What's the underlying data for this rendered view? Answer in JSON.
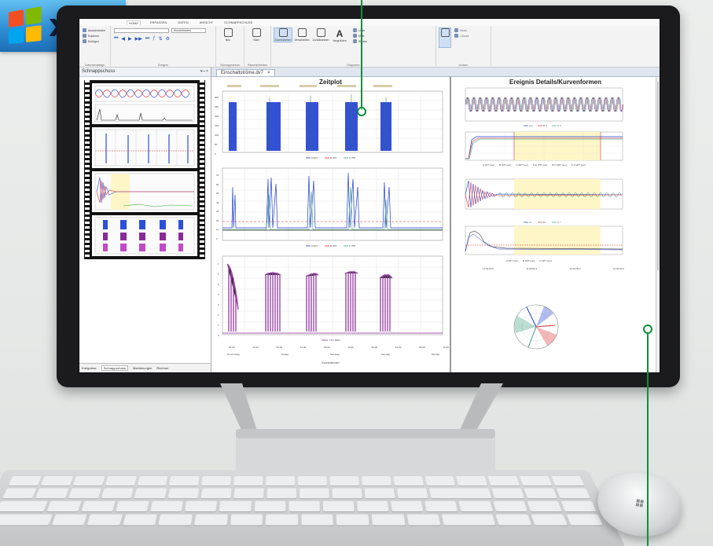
{
  "badge": {
    "text": "x64",
    "logo_colors": [
      "#f25022",
      "#7fba00",
      "#00a4ef",
      "#ffb900"
    ]
  },
  "ribbon": {
    "tabs": [
      "HOME",
      "ERFASSEN",
      "DATEN",
      "ANSICHT",
      "SCHNAPPSCHUSS"
    ],
    "groups": [
      {
        "label": "Zwischenablage",
        "buttons": [
          "Ausschneiden",
          "Kopieren",
          "Einfügen"
        ]
      },
      {
        "label": "Ereignis",
        "buttons": [
          "Kurvenformen"
        ]
      },
      {
        "label": "Schnappschuss",
        "buttons": [
          "Neu"
        ]
      },
      {
        "label": "Reportschreiber",
        "buttons": [
          "Start"
        ]
      },
      {
        "label": "Diagramm",
        "buttons": [
          "Zoomrahmen",
          "Verschieben",
          "Zurücksetzen",
          "Vergrößern",
          "Links",
          "Mitte",
          "Rechts"
        ]
      },
      {
        "label": "Achsen",
        "buttons": [
          "Skala",
          "Lineare"
        ]
      }
    ]
  },
  "snap_panel": {
    "title": "Schnappschuss",
    "bottom_tabs": [
      "Ereignisse",
      "Schnappschuss",
      "Markierungen",
      "Rechner"
    ]
  },
  "document": {
    "tab_label": "Einschaltströme.dv7",
    "tab_close": "×"
  },
  "zeitplot": {
    "title": "Zeitplot",
    "legend1": [
      "A WIT",
      "B WIT",
      "C WIT"
    ],
    "legend2": [
      "A WIT",
      "B WIT",
      "C WIT"
    ],
    "legend3": [
      "TOT RMS"
    ],
    "x_tick_times": [
      "00:00",
      "12:00",
      "00:00",
      "12:00",
      "00:00",
      "12:00",
      "00:00",
      "12:00",
      "00:00",
      "12:00"
    ],
    "x_days": [
      "Donnerstag",
      "Freitag",
      "Samstag",
      "Sonntag",
      "Montag"
    ],
    "xlabel": "Kurvenformen",
    "panel1_yticks": [
      "300",
      "250",
      "200",
      "150",
      "100",
      "50",
      "0"
    ],
    "panel2_yticks": [
      "70",
      "60",
      "50",
      "40",
      "30",
      "20",
      "10",
      "0"
    ],
    "panel3_yticks": [
      "7",
      "6",
      "5",
      "4",
      "3",
      "2",
      "1",
      "0"
    ]
  },
  "details": {
    "title": "Ereignis Details/Kurvenformen",
    "x_ticks": [
      "11:00:00,0",
      "11:00:00,1",
      "11:00:00,2",
      "11:00:00,3"
    ],
    "legend_b": [
      "A V",
      "B V",
      "C V"
    ],
    "legend_c": [
      "A WIT (ver)",
      "B WIT (ver)",
      "C WIT (ver)",
      "N-E WIT (ver)",
      "B-C WIT (ver)",
      "C-A WIT (ver)"
    ],
    "legend_d": [
      "A I",
      "B I",
      "C I"
    ],
    "legend_e": [
      "A WIT (ver)",
      "B WIT (ver)",
      "C WIT (ver)"
    ]
  },
  "colors": {
    "green_callout": "#0e8f3a",
    "blue": "#1f3fd1",
    "purple": "#8a2a9a",
    "red": "#d33"
  }
}
